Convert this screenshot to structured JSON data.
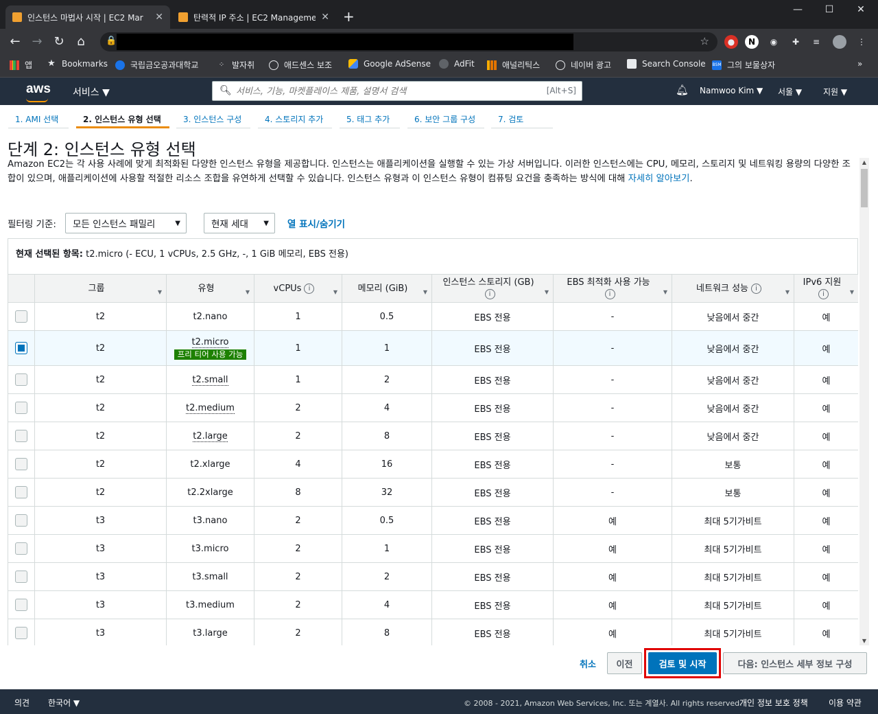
{
  "browser": {
    "tabs": [
      {
        "title": "인스턴스 마법사 시작 | EC2 Mar",
        "active": true
      },
      {
        "title": "탄력적 IP 주소 | EC2 Manageme",
        "active": false
      }
    ],
    "new_tab": "+",
    "bookmarks": [
      {
        "label": "앱",
        "icon": "apps-grid-icon"
      },
      {
        "label": "Bookmarks",
        "icon": "star-icon"
      },
      {
        "label": "국립금오공과대학교",
        "icon": "globe-icon"
      },
      {
        "label": "발자취",
        "icon": "dots-icon"
      },
      {
        "label": "애드센스 보조",
        "icon": "globe-icon"
      },
      {
        "label": "Google AdSense",
        "icon": "adsense-icon"
      },
      {
        "label": "AdFit",
        "icon": "adfit-icon"
      },
      {
        "label": "애널리틱스",
        "icon": "analytics-icon"
      },
      {
        "label": "네이버 광고",
        "icon": "globe-icon"
      },
      {
        "label": "Search Console",
        "icon": "search-console-icon"
      },
      {
        "label": "그의 보물상자",
        "icon": "bsm-icon"
      }
    ],
    "more_bookmarks": "»"
  },
  "aws": {
    "logo": "aws",
    "services": "서비스 ▼",
    "search_placeholder": "서비스, 기능, 마켓플레이스 제품, 설명서 검색",
    "search_hint": "[Alt+S]",
    "user": "Namwoo Kim ▼",
    "region": "서울 ▼",
    "support": "지원 ▼"
  },
  "steps": [
    {
      "label": "1. AMI 선택",
      "active": false
    },
    {
      "label": "2. 인스턴스 유형 선택",
      "active": true
    },
    {
      "label": "3. 인스턴스 구성",
      "active": false
    },
    {
      "label": "4. 스토리지 추가",
      "active": false
    },
    {
      "label": "5. 태그 추가",
      "active": false
    },
    {
      "label": "6. 보안 그룹 구성",
      "active": false
    },
    {
      "label": "7. 검토",
      "active": false
    }
  ],
  "page": {
    "title": "단계 2: 인스턴스 유형 선택",
    "description": "Amazon EC2는 각 사용 사례에 맞게 최적화된 다양한 인스턴스 유형을 제공합니다. 인스턴스는 애플리케이션을 실행할 수 있는 가상 서버입니다. 이러한 인스턴스에는 CPU, 메모리, 스토리지 및 네트워킹 용량의 다양한 조합이 있으며, 애플리케이션에 사용할 적절한 리소스 조합을 유연하게 선택할 수 있습니다. 인스턴스 유형과 이 인스턴스 유형이 컴퓨팅 요건을 충족하는 방식에 대해 ",
    "learn_more": "자세히 알아보기",
    "learn_more_tail": "."
  },
  "filter": {
    "label": "필터링 기준:",
    "family": "모든 인스턴스 패밀리",
    "generation": "현재 세대",
    "toggle_columns": "열 표시/숨기기"
  },
  "selection": {
    "label": "현재 선택된 항목:",
    "value": "t2.micro (- ECU, 1 vCPUs, 2.5 GHz, -, 1 GiB 메모리, EBS 전용)"
  },
  "table": {
    "headers": {
      "group": "그룹",
      "type": "유형",
      "vcpus": "vCPUs",
      "memory": "메모리 (GiB)",
      "storage": "인스턴스 스토리지 (GB)",
      "ebs": "EBS 최적화 사용 가능",
      "network": "네트워크 성능",
      "ipv6": "IPv6 지원"
    },
    "free_tier_badge": "프리 티어 사용 가능",
    "rows": [
      {
        "group": "t2",
        "type": "t2.nano",
        "vcpus": "1",
        "memory": "0.5",
        "storage": "EBS 전용",
        "ebs": "-",
        "network": "낮음에서 중간",
        "ipv6": "예",
        "selected": false,
        "free": false,
        "dotted": false
      },
      {
        "group": "t2",
        "type": "t2.micro",
        "vcpus": "1",
        "memory": "1",
        "storage": "EBS 전용",
        "ebs": "-",
        "network": "낮음에서 중간",
        "ipv6": "예",
        "selected": true,
        "free": true,
        "dotted": true
      },
      {
        "group": "t2",
        "type": "t2.small",
        "vcpus": "1",
        "memory": "2",
        "storage": "EBS 전용",
        "ebs": "-",
        "network": "낮음에서 중간",
        "ipv6": "예",
        "selected": false,
        "free": false,
        "dotted": true
      },
      {
        "group": "t2",
        "type": "t2.medium",
        "vcpus": "2",
        "memory": "4",
        "storage": "EBS 전용",
        "ebs": "-",
        "network": "낮음에서 중간",
        "ipv6": "예",
        "selected": false,
        "free": false,
        "dotted": true
      },
      {
        "group": "t2",
        "type": "t2.large",
        "vcpus": "2",
        "memory": "8",
        "storage": "EBS 전용",
        "ebs": "-",
        "network": "낮음에서 중간",
        "ipv6": "예",
        "selected": false,
        "free": false,
        "dotted": true
      },
      {
        "group": "t2",
        "type": "t2.xlarge",
        "vcpus": "4",
        "memory": "16",
        "storage": "EBS 전용",
        "ebs": "-",
        "network": "보통",
        "ipv6": "예",
        "selected": false,
        "free": false,
        "dotted": false
      },
      {
        "group": "t2",
        "type": "t2.2xlarge",
        "vcpus": "8",
        "memory": "32",
        "storage": "EBS 전용",
        "ebs": "-",
        "network": "보통",
        "ipv6": "예",
        "selected": false,
        "free": false,
        "dotted": false
      },
      {
        "group": "t3",
        "type": "t3.nano",
        "vcpus": "2",
        "memory": "0.5",
        "storage": "EBS 전용",
        "ebs": "예",
        "network": "최대 5기가비트",
        "ipv6": "예",
        "selected": false,
        "free": false,
        "dotted": false
      },
      {
        "group": "t3",
        "type": "t3.micro",
        "vcpus": "2",
        "memory": "1",
        "storage": "EBS 전용",
        "ebs": "예",
        "network": "최대 5기가비트",
        "ipv6": "예",
        "selected": false,
        "free": false,
        "dotted": false
      },
      {
        "group": "t3",
        "type": "t3.small",
        "vcpus": "2",
        "memory": "2",
        "storage": "EBS 전용",
        "ebs": "예",
        "network": "최대 5기가비트",
        "ipv6": "예",
        "selected": false,
        "free": false,
        "dotted": false
      },
      {
        "group": "t3",
        "type": "t3.medium",
        "vcpus": "2",
        "memory": "4",
        "storage": "EBS 전용",
        "ebs": "예",
        "network": "최대 5기가비트",
        "ipv6": "예",
        "selected": false,
        "free": false,
        "dotted": false
      },
      {
        "group": "t3",
        "type": "t3.large",
        "vcpus": "2",
        "memory": "8",
        "storage": "EBS 전용",
        "ebs": "예",
        "network": "최대 5기가비트",
        "ipv6": "예",
        "selected": false,
        "free": false,
        "dotted": false
      }
    ]
  },
  "actions": {
    "cancel": "취소",
    "previous": "이전",
    "review_launch": "검토 및 시작",
    "next": "다음: 인스턴스 세부 정보 구성"
  },
  "footer": {
    "feedback": "의견",
    "language": "한국어 ▼",
    "copyright": "© 2008 - 2021, Amazon Web Services, Inc. 또는 계열사. All rights reserved.",
    "privacy": "개인 정보 보호 정책",
    "terms": "이용 약관"
  },
  "colors": {
    "aws_nav": "#232f3e",
    "primary": "#0073bb",
    "active_step": "#eb8c0d",
    "free_tier": "#1d8102",
    "highlight_box": "#e00000"
  }
}
